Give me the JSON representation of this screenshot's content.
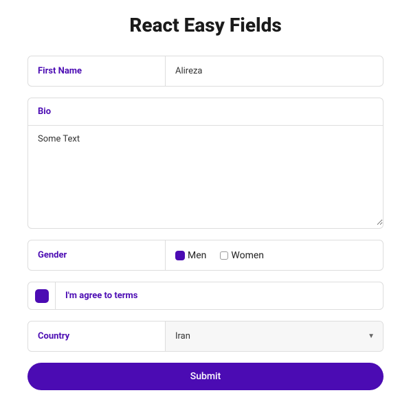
{
  "title": "React Easy Fields",
  "fields": {
    "firstName": {
      "label": "First Name",
      "value": "Alireza"
    },
    "bio": {
      "label": "Bio",
      "value": "Some Text"
    },
    "gender": {
      "label": "Gender",
      "options": {
        "men": "Men",
        "women": "Women"
      },
      "selected": "men"
    },
    "terms": {
      "label": "I'm agree to terms",
      "checked": true
    },
    "country": {
      "label": "Country",
      "value": "Iran"
    }
  },
  "submit": {
    "label": "Submit"
  }
}
